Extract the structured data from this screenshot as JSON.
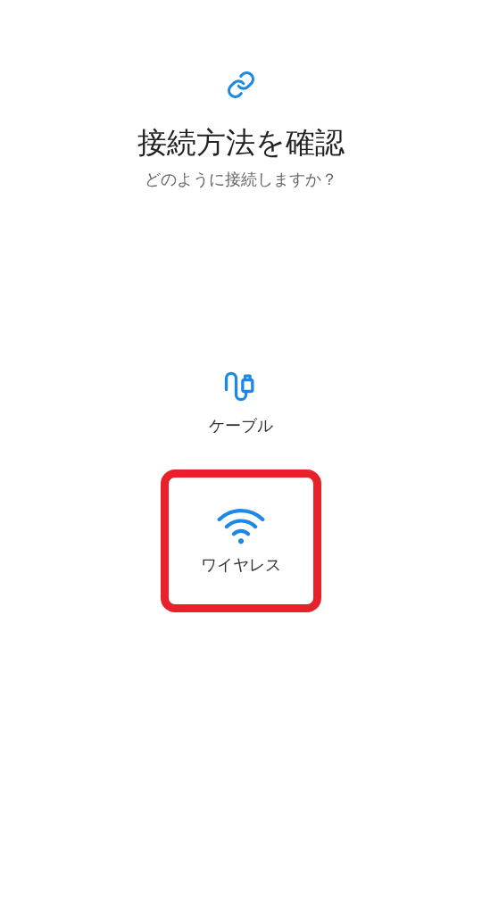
{
  "header": {
    "title": "接続方法を確認",
    "subtitle": "どのように接続しますか？"
  },
  "options": [
    {
      "kind": "cable",
      "label": "ケーブル",
      "highlighted": false
    },
    {
      "kind": "wireless",
      "label": "ワイヤレス",
      "highlighted": true
    }
  ]
}
